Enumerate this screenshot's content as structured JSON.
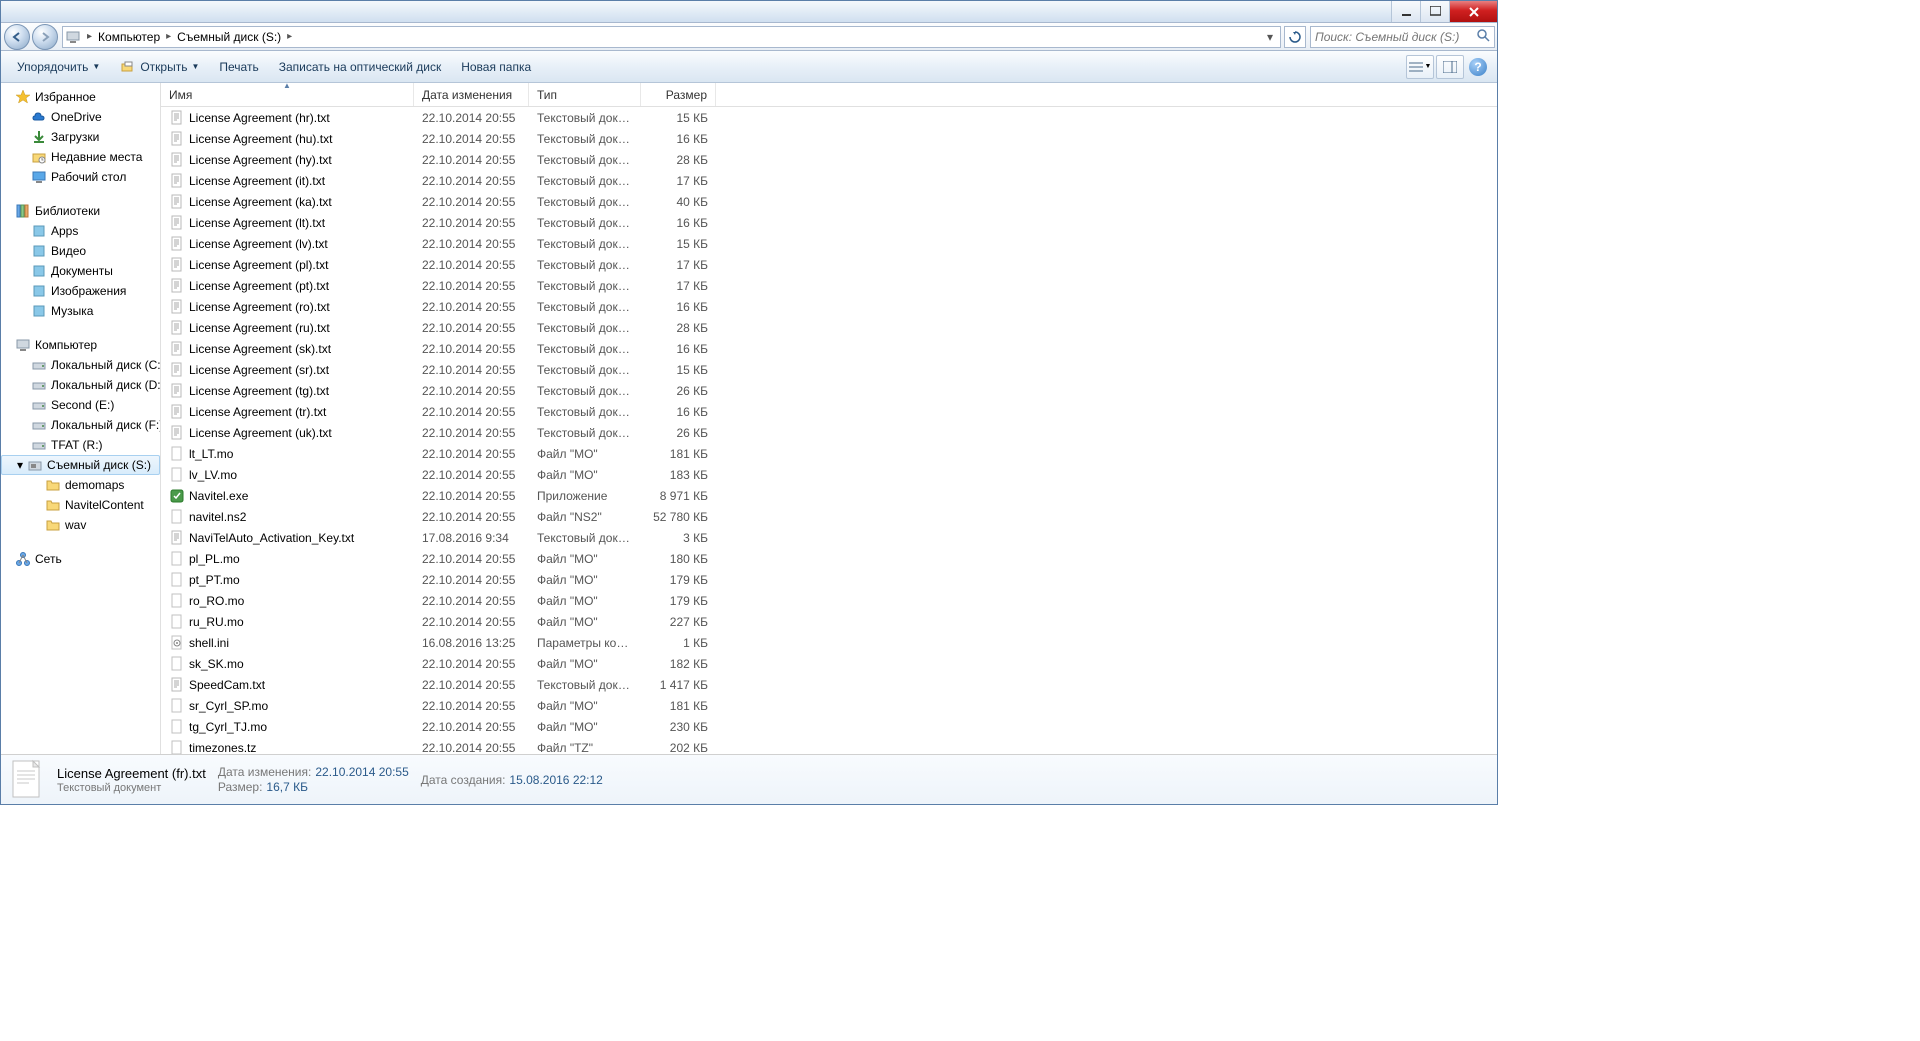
{
  "breadcrumb": {
    "seg1": "Компьютер",
    "seg2": "Съемный диск (S:)"
  },
  "search": {
    "placeholder": "Поиск: Съемный диск (S:)"
  },
  "toolbar": {
    "organize": "Упорядочить",
    "open": "Открыть",
    "print": "Печать",
    "burn": "Записать на оптический диск",
    "newfolder": "Новая папка"
  },
  "sidebar": {
    "fav_head": "Избранное",
    "fav": [
      "OneDrive",
      "Загрузки",
      "Недавние места",
      "Рабочий стол"
    ],
    "lib_head": "Библиотеки",
    "lib": [
      "Apps",
      "Видео",
      "Документы",
      "Изображения",
      "Музыка"
    ],
    "comp_head": "Компьютер",
    "comp": [
      "Локальный диск (C:)",
      "Локальный диск (D:)",
      "Second (E:)",
      "Локальный диск (F:)",
      "TFAT (R:)",
      "Съемный диск (S:)"
    ],
    "sub": [
      "demomaps",
      "NavitelContent",
      "wav"
    ],
    "net_head": "Сеть"
  },
  "columns": {
    "name": "Имя",
    "date": "Дата изменения",
    "type": "Тип",
    "size": "Размер"
  },
  "files": [
    {
      "icon": "txt",
      "name": "License Agreement (hr).txt",
      "date": "22.10.2014 20:55",
      "type": "Текстовый докум...",
      "size": "15 КБ"
    },
    {
      "icon": "txt",
      "name": "License Agreement (hu).txt",
      "date": "22.10.2014 20:55",
      "type": "Текстовый докум...",
      "size": "16 КБ"
    },
    {
      "icon": "txt",
      "name": "License Agreement (hy).txt",
      "date": "22.10.2014 20:55",
      "type": "Текстовый докум...",
      "size": "28 КБ"
    },
    {
      "icon": "txt",
      "name": "License Agreement (it).txt",
      "date": "22.10.2014 20:55",
      "type": "Текстовый докум...",
      "size": "17 КБ"
    },
    {
      "icon": "txt",
      "name": "License Agreement (ka).txt",
      "date": "22.10.2014 20:55",
      "type": "Текстовый докум...",
      "size": "40 КБ"
    },
    {
      "icon": "txt",
      "name": "License Agreement (lt).txt",
      "date": "22.10.2014 20:55",
      "type": "Текстовый докум...",
      "size": "16 КБ"
    },
    {
      "icon": "txt",
      "name": "License Agreement (lv).txt",
      "date": "22.10.2014 20:55",
      "type": "Текстовый докум...",
      "size": "15 КБ"
    },
    {
      "icon": "txt",
      "name": "License Agreement (pl).txt",
      "date": "22.10.2014 20:55",
      "type": "Текстовый докум...",
      "size": "17 КБ"
    },
    {
      "icon": "txt",
      "name": "License Agreement (pt).txt",
      "date": "22.10.2014 20:55",
      "type": "Текстовый докум...",
      "size": "17 КБ"
    },
    {
      "icon": "txt",
      "name": "License Agreement (ro).txt",
      "date": "22.10.2014 20:55",
      "type": "Текстовый докум...",
      "size": "16 КБ"
    },
    {
      "icon": "txt",
      "name": "License Agreement (ru).txt",
      "date": "22.10.2014 20:55",
      "type": "Текстовый докум...",
      "size": "28 КБ"
    },
    {
      "icon": "txt",
      "name": "License Agreement (sk).txt",
      "date": "22.10.2014 20:55",
      "type": "Текстовый докум...",
      "size": "16 КБ"
    },
    {
      "icon": "txt",
      "name": "License Agreement (sr).txt",
      "date": "22.10.2014 20:55",
      "type": "Текстовый докум...",
      "size": "15 КБ"
    },
    {
      "icon": "txt",
      "name": "License Agreement (tg).txt",
      "date": "22.10.2014 20:55",
      "type": "Текстовый докум...",
      "size": "26 КБ"
    },
    {
      "icon": "txt",
      "name": "License Agreement (tr).txt",
      "date": "22.10.2014 20:55",
      "type": "Текстовый докум...",
      "size": "16 КБ"
    },
    {
      "icon": "txt",
      "name": "License Agreement (uk).txt",
      "date": "22.10.2014 20:55",
      "type": "Текстовый докум...",
      "size": "26 КБ"
    },
    {
      "icon": "gen",
      "name": "lt_LT.mo",
      "date": "22.10.2014 20:55",
      "type": "Файл \"MO\"",
      "size": "181 КБ"
    },
    {
      "icon": "gen",
      "name": "lv_LV.mo",
      "date": "22.10.2014 20:55",
      "type": "Файл \"MO\"",
      "size": "183 КБ"
    },
    {
      "icon": "exe",
      "name": "Navitel.exe",
      "date": "22.10.2014 20:55",
      "type": "Приложение",
      "size": "8 971 КБ"
    },
    {
      "icon": "gen",
      "name": "navitel.ns2",
      "date": "22.10.2014 20:55",
      "type": "Файл \"NS2\"",
      "size": "52 780 КБ"
    },
    {
      "icon": "txt",
      "name": "NaviTelAuto_Activation_Key.txt",
      "date": "17.08.2016 9:34",
      "type": "Текстовый докум...",
      "size": "3 КБ"
    },
    {
      "icon": "gen",
      "name": "pl_PL.mo",
      "date": "22.10.2014 20:55",
      "type": "Файл \"MO\"",
      "size": "180 КБ"
    },
    {
      "icon": "gen",
      "name": "pt_PT.mo",
      "date": "22.10.2014 20:55",
      "type": "Файл \"MO\"",
      "size": "179 КБ"
    },
    {
      "icon": "gen",
      "name": "ro_RO.mo",
      "date": "22.10.2014 20:55",
      "type": "Файл \"MO\"",
      "size": "179 КБ"
    },
    {
      "icon": "gen",
      "name": "ru_RU.mo",
      "date": "22.10.2014 20:55",
      "type": "Файл \"MO\"",
      "size": "227 КБ"
    },
    {
      "icon": "ini",
      "name": "shell.ini",
      "date": "16.08.2016 13:25",
      "type": "Параметры конф...",
      "size": "1 КБ"
    },
    {
      "icon": "gen",
      "name": "sk_SK.mo",
      "date": "22.10.2014 20:55",
      "type": "Файл \"MO\"",
      "size": "182 КБ"
    },
    {
      "icon": "txt",
      "name": "SpeedCam.txt",
      "date": "22.10.2014 20:55",
      "type": "Текстовый докум...",
      "size": "1 417 КБ"
    },
    {
      "icon": "gen",
      "name": "sr_Cyrl_SP.mo",
      "date": "22.10.2014 20:55",
      "type": "Файл \"MO\"",
      "size": "181 КБ"
    },
    {
      "icon": "gen",
      "name": "tg_Cyrl_TJ.mo",
      "date": "22.10.2014 20:55",
      "type": "Файл \"MO\"",
      "size": "230 КБ"
    },
    {
      "icon": "gen",
      "name": "timezones.tz",
      "date": "22.10.2014 20:55",
      "type": "Файл \"TZ\"",
      "size": "202 КБ"
    }
  ],
  "details": {
    "filename": "License Agreement (fr).txt",
    "subtitle": "Текстовый документ",
    "mod_label": "Дата изменения:",
    "mod_value": "22.10.2014 20:55",
    "size_label": "Размер:",
    "size_value": "16,7 КБ",
    "created_label": "Дата создания:",
    "created_value": "15.08.2016 22:12"
  }
}
